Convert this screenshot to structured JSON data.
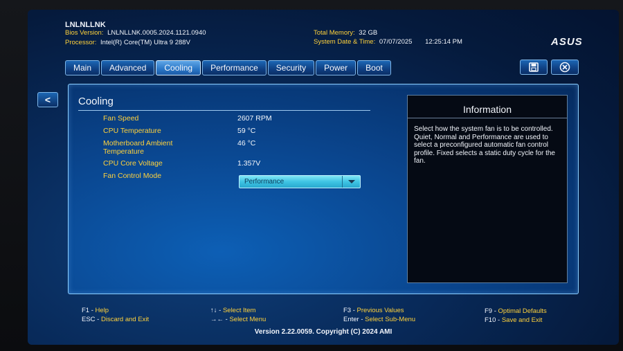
{
  "header": {
    "title": "LNLNLLNK",
    "bios_version_label": "Bios Version:",
    "bios_version": "LNLNLLNK.0005.2024.1121.0940",
    "processor_label": "Processor:",
    "processor": "Intel(R) Core(TM) Ultra 9 288V",
    "memory_label": "Total Memory:",
    "memory": "32 GB",
    "datetime_label": "System Date & Time:",
    "date": "07/07/2025",
    "time": "12:25:14 PM",
    "logo": "ASUS"
  },
  "tabs": [
    {
      "label": "Main",
      "active": false
    },
    {
      "label": "Advanced",
      "active": false
    },
    {
      "label": "Cooling",
      "active": true
    },
    {
      "label": "Performance",
      "active": false
    },
    {
      "label": "Security",
      "active": false
    },
    {
      "label": "Power",
      "active": false
    },
    {
      "label": "Boot",
      "active": false
    }
  ],
  "toolbar": {
    "save_icon": "floppy-disk-icon",
    "close_icon": "close-icon"
  },
  "back_button": "<",
  "cooling": {
    "title": "Cooling",
    "rows": [
      {
        "label": "Fan Speed",
        "value": "2607 RPM"
      },
      {
        "label": "CPU Temperature",
        "value": "59 °C"
      },
      {
        "label": "Motherboard Ambient Temperature",
        "value": "46 °C"
      },
      {
        "label": "CPU Core Voltage",
        "value": "1.357V"
      },
      {
        "label": "Fan Control Mode",
        "value": ""
      }
    ],
    "fan_mode_selected": "Performance"
  },
  "info": {
    "title": "Information",
    "text": "Select how the system fan is to be controlled.\nQuiet, Normal and Performance are used to select a preconfigured automatic fan control profile. Fixed selects a static duty cycle for the fan."
  },
  "footer": {
    "f1_key": "F1",
    "f1_desc": "Help",
    "esc_key": "ESC",
    "esc_desc": "Discard and Exit",
    "updown_key": "↑↓",
    "updown_desc": "Select Item",
    "leftright_key": "→←",
    "leftright_desc": "Select Menu",
    "f3_key": "F3",
    "f3_desc": "Previous Values",
    "enter_key": "Enter",
    "enter_desc": "Select Sub-Menu",
    "f9_key": "F9",
    "f9_desc": "Optimal Defaults",
    "f10_key": "F10",
    "f10_desc": "Save and Exit",
    "version": "Version 2.22.0059. Copyright (C) 2024 AMI"
  },
  "colors": {
    "accent_yellow": "#ffd23c",
    "panel_blue": "#0a468f",
    "dropdown_cyan": "#3fc4e3"
  }
}
